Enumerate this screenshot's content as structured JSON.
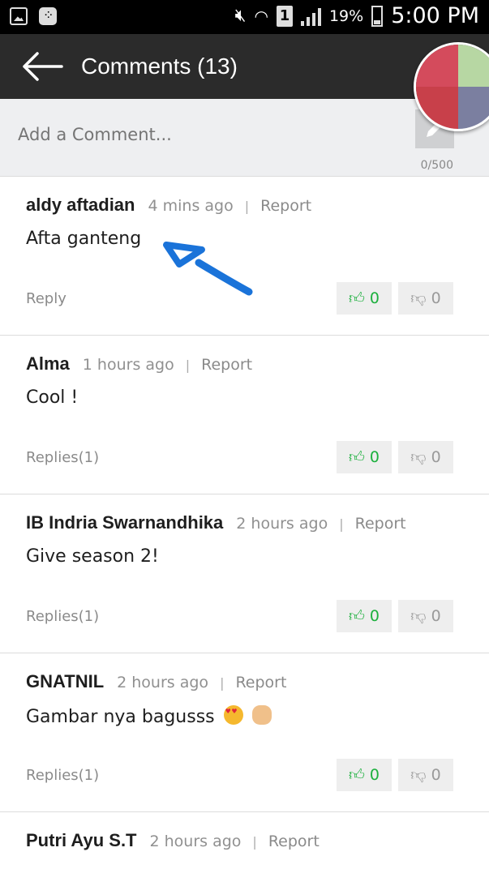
{
  "status_bar": {
    "battery": "19%",
    "sim_slot": "1",
    "time": "5:00 PM",
    "icons": [
      "gallery-icon",
      "bbm-icon",
      "mute-icon",
      "wifi-icon",
      "sim-icon",
      "signal-icon",
      "battery-icon"
    ]
  },
  "app_bar": {
    "title": "Comments (13)",
    "back_icon": "back-arrow-icon"
  },
  "comment_box": {
    "placeholder": "Add a Comment...",
    "char_count": "0/500",
    "submit_icon": "pencil-icon"
  },
  "comments": [
    {
      "author": "aldy aftadian",
      "time": "4 mins ago",
      "report": "Report",
      "text": "Afta ganteng",
      "reply": "Reply",
      "likes": "0",
      "dislikes": "0"
    },
    {
      "author": "Alma",
      "time": "1 hours ago",
      "report": "Report",
      "text": "Cool !",
      "reply": "Replies(1)",
      "likes": "0",
      "dislikes": "0"
    },
    {
      "author": "IB Indria Swarnandhika",
      "time": "2 hours ago",
      "report": "Report",
      "text": "Give season 2!",
      "reply": "Replies(1)",
      "likes": "0",
      "dislikes": "0"
    },
    {
      "author": "GNATNIL",
      "time": "2 hours ago",
      "report": "Report",
      "text": "Gambar nya bagusss",
      "reply": "Replies(1)",
      "likes": "0",
      "dislikes": "0"
    },
    {
      "author": "Putri Ayu S.T",
      "time": "2 hours ago",
      "report": "Report",
      "text": "",
      "reply": "",
      "likes": "",
      "dislikes": ""
    }
  ],
  "colors": {
    "app_bar": "#2b2b2b",
    "like": "#1db03e",
    "annotation": "#1a73d9"
  }
}
